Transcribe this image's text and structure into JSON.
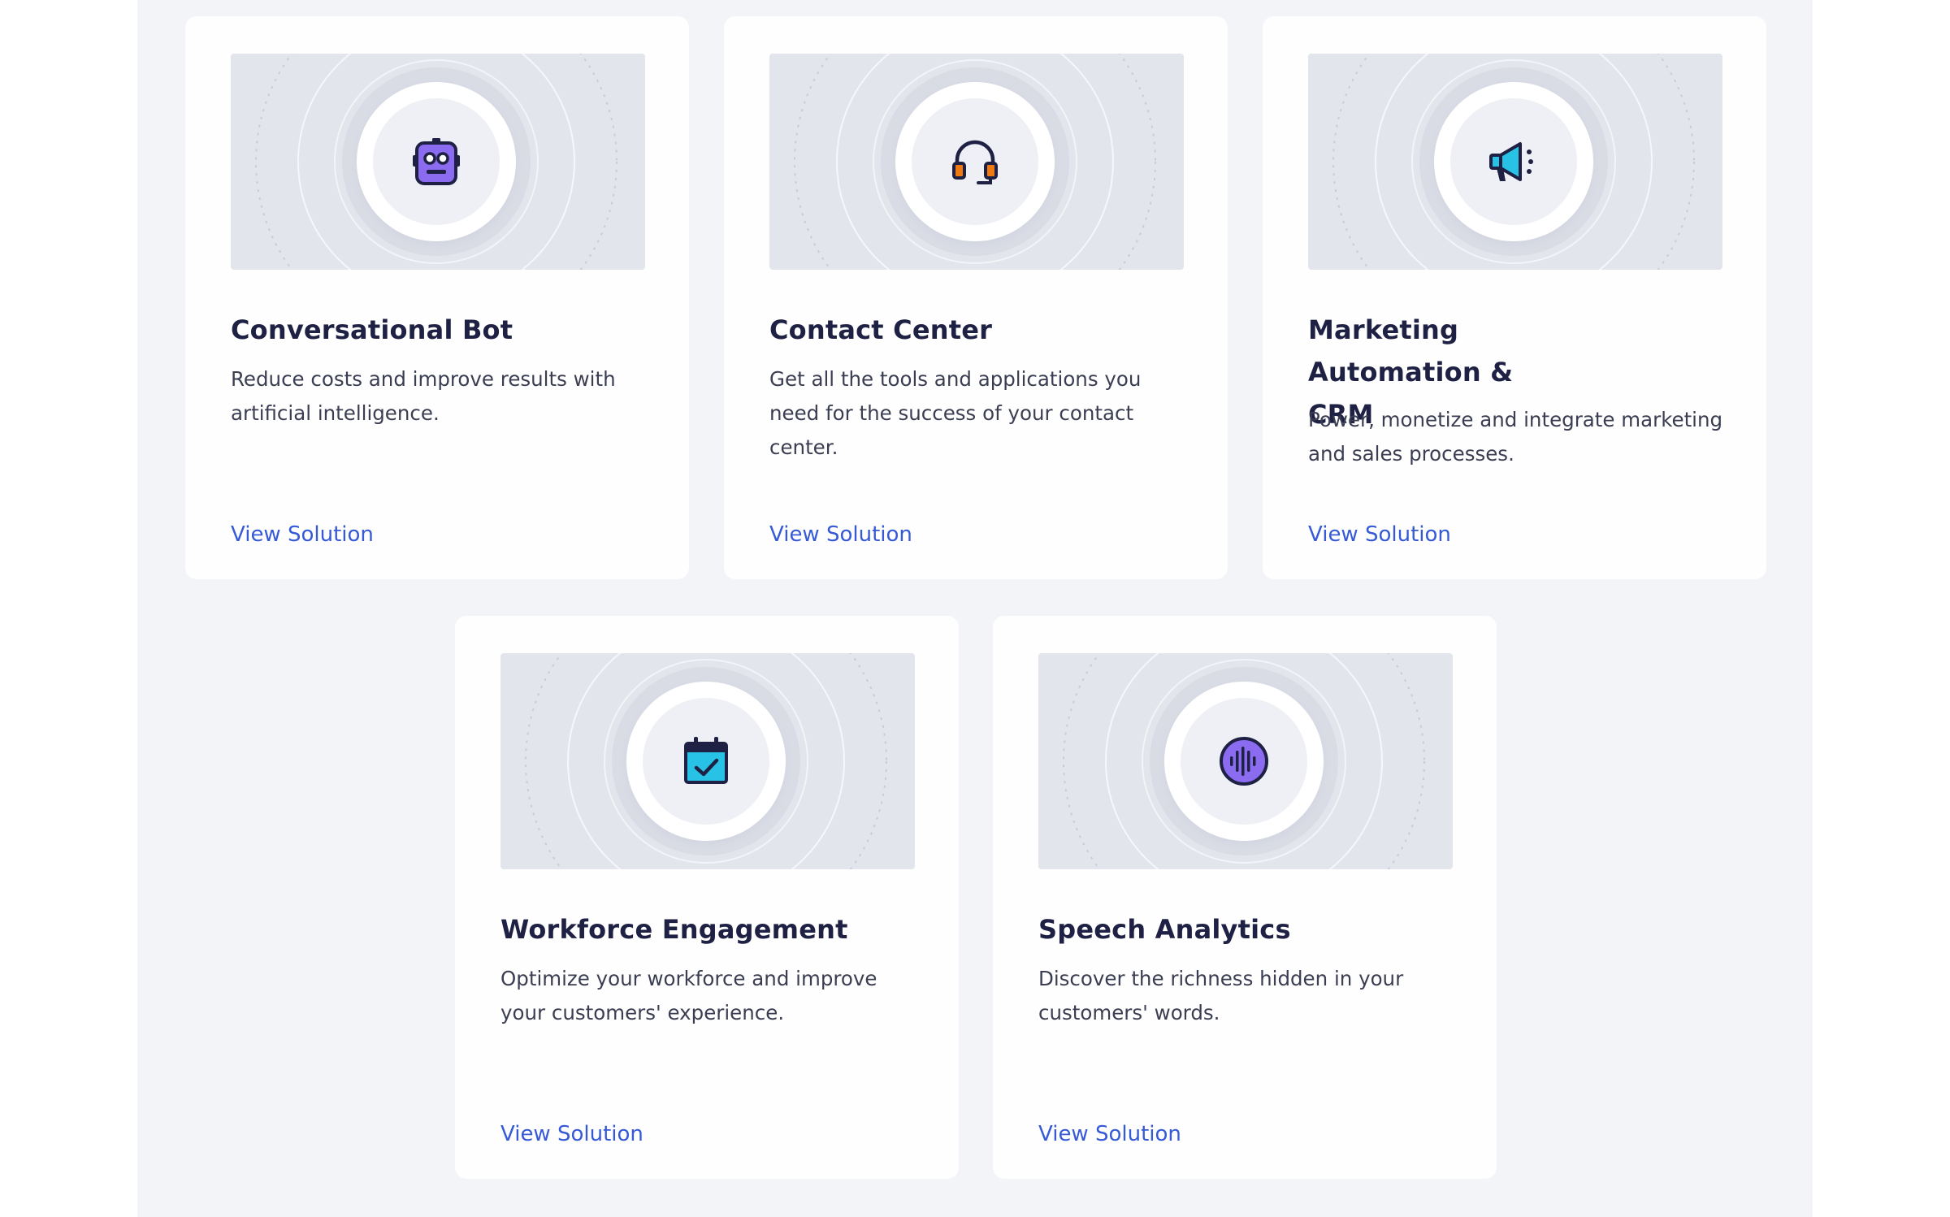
{
  "section": {
    "cards": [
      {
        "title": "Conversational Bot",
        "description": "Reduce costs and improve results with artificial intelligence.",
        "link_label": "View Solution",
        "icon": "robot-icon",
        "icon_color": "#8b6cf0"
      },
      {
        "title": "Contact Center",
        "description": "Get all the tools and applications you need for the success of your contact center.",
        "link_label": "View Solution",
        "icon": "headset-icon",
        "icon_color": "#f07a12"
      },
      {
        "title": "Marketing Automation & CRM",
        "description": "Power, monetize and integrate marketing and sales processes.",
        "link_label": "View Solution",
        "icon": "megaphone-icon",
        "icon_color": "#27c2e6"
      },
      {
        "title": "Workforce Engagement",
        "description": "Optimize your workforce and improve your customers' experience.",
        "link_label": "View Solution",
        "icon": "calendar-check-icon",
        "icon_color": "#27c2e6"
      },
      {
        "title": "Speech Analytics",
        "description": "Discover the richness hidden in your customers' words.",
        "link_label": "View Solution",
        "icon": "voice-wave-icon",
        "icon_color": "#8b6cf0"
      }
    ]
  },
  "colors": {
    "section_background": "#f2f4f7",
    "card_background": "#fefefe",
    "title": "#1e2144",
    "body_text": "#3b3e52",
    "link": "#3659d6",
    "icon_outline": "#1e2144"
  }
}
